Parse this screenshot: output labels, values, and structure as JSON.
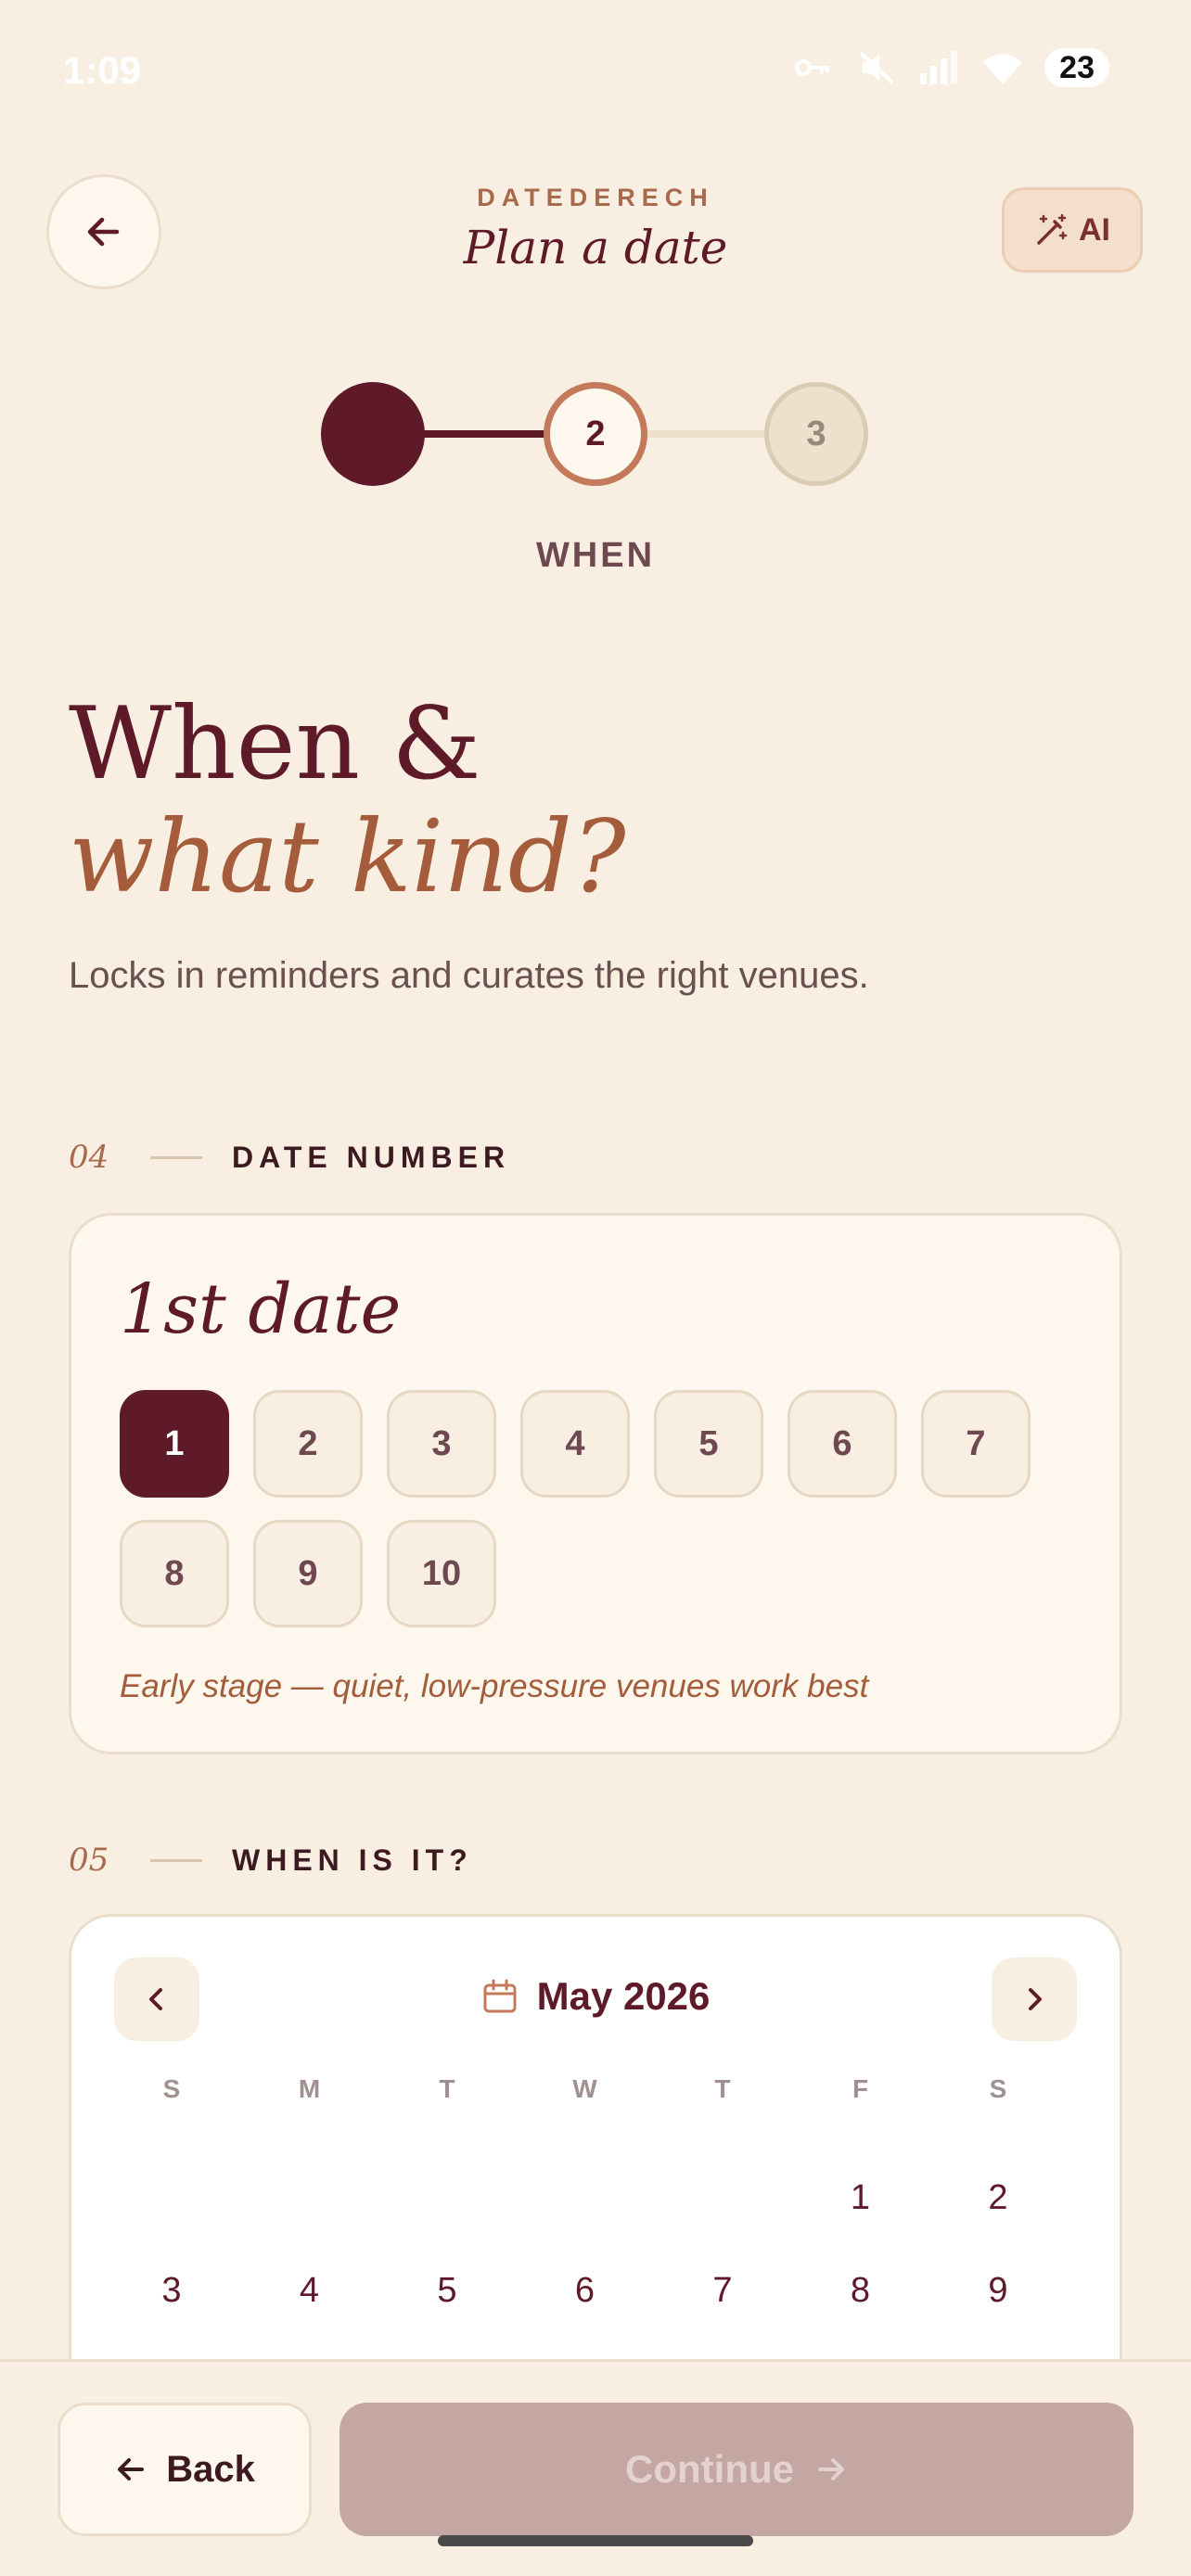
{
  "status_bar": {
    "time": "1:09",
    "battery": "23"
  },
  "header": {
    "brand": "DATEDERECH",
    "title": "Plan a date",
    "ai_label": "AI"
  },
  "stepper": {
    "steps": [
      {
        "number": ""
      },
      {
        "number": "2"
      },
      {
        "number": "3"
      }
    ],
    "current_label": "WHEN"
  },
  "headline": {
    "line1": "When &",
    "line2": "what kind?"
  },
  "subtitle": "Locks in reminders and curates the right venues.",
  "date_number": {
    "section_num": "04",
    "section_title": "DATE NUMBER",
    "display": "1st date",
    "options": [
      "1",
      "2",
      "3",
      "4",
      "5",
      "6",
      "7",
      "8",
      "9",
      "10"
    ],
    "selected": "1",
    "hint": "Early stage — quiet, low-pressure venues work best"
  },
  "calendar": {
    "section_num": "05",
    "section_title": "WHEN IS IT?",
    "month_label": "May 2026",
    "weekdays": [
      "S",
      "M",
      "T",
      "W",
      "T",
      "F",
      "S"
    ],
    "first_weekday_index": 5,
    "visible_days": [
      "1",
      "2",
      "3",
      "4",
      "5",
      "6",
      "7",
      "8",
      "9"
    ]
  },
  "footer": {
    "back_label": "Back",
    "continue_label": "Continue"
  },
  "colors": {
    "primary": "#5E1A28",
    "accent": "#A45C3A",
    "background": "#F8EEE2",
    "continue_disabled": "#C4A7A2"
  }
}
